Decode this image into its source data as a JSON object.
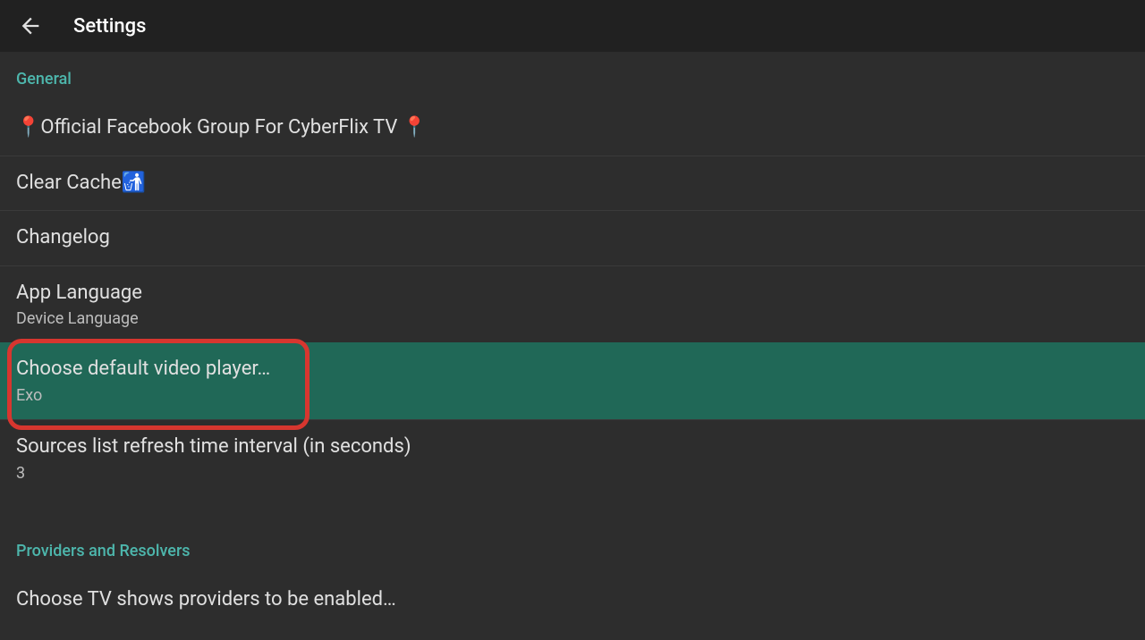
{
  "header": {
    "title": "Settings"
  },
  "sections": [
    {
      "label": "General",
      "items": [
        {
          "title": "📍Official Facebook Group For CyberFlix TV 📍"
        },
        {
          "title": "Clear Cache🚮"
        },
        {
          "title": "Changelog"
        },
        {
          "title": "App Language",
          "subtitle": "Device Language"
        },
        {
          "title": "Choose default video player…",
          "subtitle": "Exo",
          "highlighted": true
        },
        {
          "title": "Sources list refresh time interval (in seconds)",
          "subtitle": "3"
        }
      ]
    },
    {
      "label": "Providers and Resolvers",
      "items": [
        {
          "title": "Choose TV shows providers to be enabled…"
        }
      ]
    }
  ]
}
